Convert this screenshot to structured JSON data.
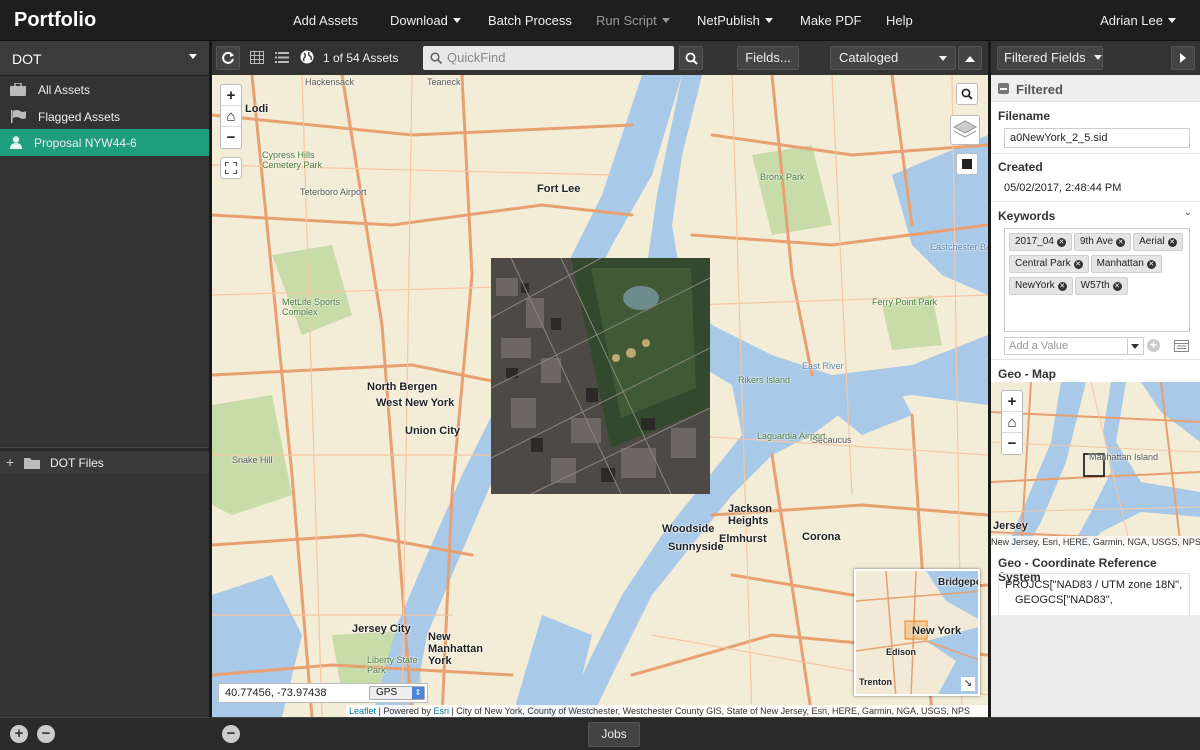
{
  "app": {
    "title": "Portfolio",
    "user": "Adrian Lee"
  },
  "menu": [
    {
      "label": "Add Assets",
      "caret": false,
      "disabled": false
    },
    {
      "label": "Download",
      "caret": true,
      "disabled": false
    },
    {
      "label": "Batch Process",
      "caret": false,
      "disabled": false
    },
    {
      "label": "Run Script",
      "caret": true,
      "disabled": true
    },
    {
      "label": "NetPublish",
      "caret": true,
      "disabled": false
    },
    {
      "label": "Make PDF",
      "caret": false,
      "disabled": false
    },
    {
      "label": "Help",
      "caret": false,
      "disabled": false
    }
  ],
  "sidebar": {
    "catalog": "DOT",
    "items": [
      {
        "label": "All Assets",
        "icon": "briefcase-icon"
      },
      {
        "label": "Flagged Assets",
        "icon": "flag-icon"
      },
      {
        "label": "Proposal NYW44-6",
        "icon": "user-icon",
        "selected": true
      }
    ],
    "folders_label": "DOT Files"
  },
  "toolbar": {
    "asset_count": "1 of 54 Assets",
    "search_placeholder": "QuickFind",
    "fields_label": "Fields...",
    "status_select": "Cataloged"
  },
  "map": {
    "coordinates": "40.77456, -73.97438",
    "coord_system": "GPS",
    "attribution_leaflet": "Leaflet",
    "attribution_rest": "| Powered by",
    "attribution_esri": "Esri",
    "attribution_sources": "| City of New York, County of Westchester, Westchester County GIS, State of New Jersey, Esri, HERE, Garmin, NGA, USGS, NPS",
    "labels": [
      {
        "text": "Hackensack",
        "cls": "sm"
      },
      {
        "text": "Teaneck",
        "cls": "sm"
      },
      {
        "text": "Lodi",
        "cls": ""
      },
      {
        "text": "Fort Lee",
        "cls": ""
      },
      {
        "text": "Cypress Hills Cemetery Park",
        "cls": "park"
      },
      {
        "text": "Teterboro Airport",
        "cls": "sm"
      },
      {
        "text": "Bronx Park",
        "cls": "park"
      },
      {
        "text": "Eastchester Bay",
        "cls": "water"
      },
      {
        "text": "MetLife Sports Complex",
        "cls": "park"
      },
      {
        "text": "Ferry Point Park",
        "cls": "park"
      },
      {
        "text": "North Bergen",
        "cls": ""
      },
      {
        "text": "West New York",
        "cls": ""
      },
      {
        "text": "Union City",
        "cls": ""
      },
      {
        "text": "East River",
        "cls": "water"
      },
      {
        "text": "Rikers Island",
        "cls": "park"
      },
      {
        "text": "Secaucus",
        "cls": "sm"
      },
      {
        "text": "Laguardia Airport",
        "cls": "park"
      },
      {
        "text": "Jackson Heights",
        "cls": ""
      },
      {
        "text": "Woodside",
        "cls": ""
      },
      {
        "text": "Sunnyside",
        "cls": ""
      },
      {
        "text": "Elmhurst",
        "cls": ""
      },
      {
        "text": "Corona",
        "cls": ""
      },
      {
        "text": "Jersey City",
        "cls": ""
      },
      {
        "text": "New Manhattan York",
        "cls": ""
      },
      {
        "text": "Liberty State Park",
        "cls": "park"
      },
      {
        "text": "Snake Hill",
        "cls": "sm"
      }
    ],
    "mini_labels": [
      "Bridgeport",
      "New York",
      "Edison",
      "Trenton"
    ]
  },
  "panel": {
    "title": "Filtered Fields",
    "section": "Filtered",
    "filename_label": "Filename",
    "filename_value": "a0NewYork_2_5.sid",
    "created_label": "Created",
    "created_value": "05/02/2017, 2:48:44 PM",
    "keywords_label": "Keywords",
    "keywords": [
      "2017_04",
      "9th Ave",
      "Aerial",
      "Central Park",
      "Manhattan",
      "NewYork",
      "W57th"
    ],
    "add_value_placeholder": "Add a Value",
    "geo_map_label": "Geo - Map",
    "geo_map_labels": [
      "Jersey",
      "Manhattan Island"
    ],
    "geo_map_attribution": "New Jersey, Esri, HERE, Garmin, NGA, USGS, NPS",
    "crs_label": "Geo - Coordinate Reference System",
    "crs_line1": "PROJCS[\"NAD83 / UTM zone 18N\",",
    "crs_line2": "GEOGCS[\"NAD83\","
  },
  "footer": {
    "jobs_label": "Jobs"
  },
  "colors": {
    "accent": "#1e9e7c",
    "topbar": "#1e1e1e",
    "road": "#e8a070",
    "water": "#a9c9e8",
    "park": "#c8dcaa"
  }
}
